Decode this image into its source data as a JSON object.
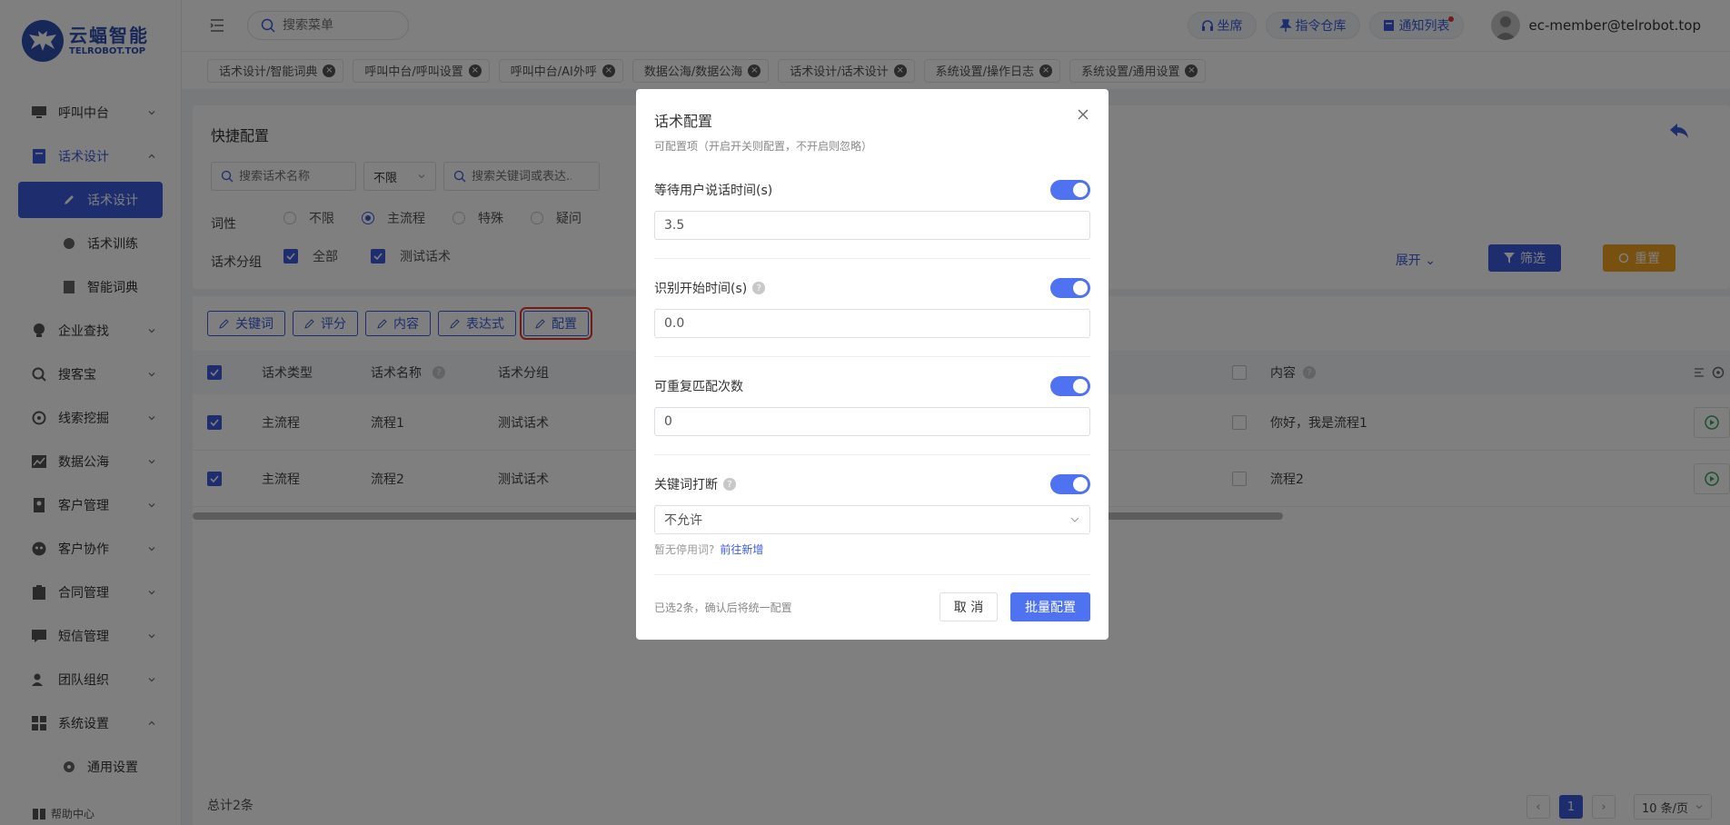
{
  "logo": {
    "cn": "云蝠智能",
    "en": "TELROBOT.TOP"
  },
  "sidebar": {
    "items": [
      {
        "label": "呼叫中台",
        "icon": "monitor-icon"
      },
      {
        "label": "话术设计",
        "icon": "book-icon"
      },
      {
        "label": "话术设计",
        "icon": "pen-icon"
      },
      {
        "label": "话术训练",
        "icon": "chat-icon"
      },
      {
        "label": "智能词典",
        "icon": "dictionary-icon"
      },
      {
        "label": "企业查找",
        "icon": "bulb-icon"
      },
      {
        "label": "搜客宝",
        "icon": "search-plus-icon"
      },
      {
        "label": "线索挖掘",
        "icon": "target-icon"
      },
      {
        "label": "数据公海",
        "icon": "chart-icon"
      },
      {
        "label": "客户管理",
        "icon": "contact-icon"
      },
      {
        "label": "客户协作",
        "icon": "team-icon"
      },
      {
        "label": "合同管理",
        "icon": "clipboard-icon"
      },
      {
        "label": "短信管理",
        "icon": "message-icon"
      },
      {
        "label": "团队组织",
        "icon": "users-icon"
      },
      {
        "label": "系统设置",
        "icon": "grid-icon"
      },
      {
        "label": "通用设置",
        "icon": "gear-icon"
      }
    ],
    "help": "帮助中心"
  },
  "header": {
    "search_placeholder": "搜索菜单",
    "buttons": [
      "坐席",
      "指令仓库",
      "通知列表"
    ],
    "user": "ec-member@telrobot.top"
  },
  "tags": [
    "话术设计/智能词典",
    "呼叫中台/呼叫设置",
    "呼叫中台/AI外呼",
    "数据公海/数据公海",
    "话术设计/话术设计",
    "系统设置/操作日志",
    "系统设置/通用设置"
  ],
  "quick": {
    "title": "快捷配置",
    "search_name_placeholder": "搜索话术名称",
    "select_value": "不限",
    "search_kw_placeholder": "搜索关键词或表达...",
    "prop_label": "词性",
    "props": [
      "不限",
      "主流程",
      "特殊",
      "疑问"
    ],
    "group_label": "话术分组",
    "groups": [
      "全部",
      "测试话术"
    ],
    "expand": "展开",
    "filter": "筛选",
    "reset": "重置"
  },
  "toolbar": [
    "关键词",
    "评分",
    "内容",
    "表达式",
    "配置"
  ],
  "table": {
    "headers": {
      "type": "话术类型",
      "name": "话术名称",
      "group": "话术分组",
      "content": "内容"
    },
    "rows": [
      {
        "type": "主流程",
        "name": "流程1",
        "group": "测试话术",
        "content": "你好，我是流程1"
      },
      {
        "type": "主流程",
        "name": "流程2",
        "group": "测试话术",
        "content": "流程2"
      }
    ],
    "total": "总计2条",
    "page": "1",
    "page_size": "10 条/页"
  },
  "modal": {
    "title": "话术配置",
    "desc": "可配置项（开启开关则配置，不开启则忽略）",
    "fields": [
      {
        "label": "等待用户说话时间(s)",
        "value": "3.5"
      },
      {
        "label": "识别开始时间(s)",
        "value": "0.0"
      },
      {
        "label": "可重复匹配次数",
        "value": "0"
      },
      {
        "label": "关键词打断",
        "value": "不允许"
      }
    ],
    "hint": "暂无停用词?",
    "hint_link": "前往新增",
    "footer": "已选2条，确认后将统一配置",
    "cancel": "取 消",
    "ok": "批量配置"
  }
}
